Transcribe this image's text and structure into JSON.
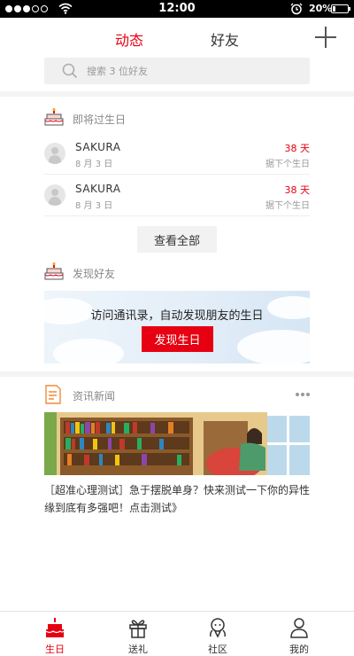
{
  "status_bar": {
    "time": "12:00",
    "battery": "20%",
    "battery_level": 0.2,
    "signal_icon": "signal-dots-icon",
    "wifi_icon": "wifi-icon",
    "alarm_icon": "alarm-icon"
  },
  "nav": {
    "tabs": [
      {
        "label": "动态",
        "active": true
      },
      {
        "label": "好友",
        "active": false
      }
    ],
    "add_icon": "plus-icon"
  },
  "search": {
    "placeholder": "搜索 3 位好友"
  },
  "upcoming": {
    "title": "即将过生日",
    "icon": "cake-icon",
    "friends": [
      {
        "name": "SAKURA",
        "date": "8 月 3 日",
        "days": "38 天",
        "note": "据下个生日"
      },
      {
        "name": "SAKURA",
        "date": "8 月 3 日",
        "days": "38 天",
        "note": "据下个生日"
      }
    ],
    "view_all": "查看全部"
  },
  "discover": {
    "title": "发现好友",
    "icon": "cake-icon",
    "banner_text": "访问通讯录，自动发现朋友的生日",
    "button": "发现生日"
  },
  "news": {
    "title": "资讯新闻",
    "icon": "news-icon",
    "more_icon": "more-dots-icon",
    "article": "［超准心理测试］急于摆脱单身？快来测试一下你的异性缘到底有多强吧！点击测试》"
  },
  "tabbar": [
    {
      "label": "生日",
      "icon": "birthday-cake-icon",
      "active": true
    },
    {
      "label": "送礼",
      "icon": "gift-icon",
      "active": false
    },
    {
      "label": "社区",
      "icon": "community-icon",
      "active": false
    },
    {
      "label": "我的",
      "icon": "profile-icon",
      "active": false
    }
  ],
  "colors": {
    "accent": "#e60012",
    "muted_text": "#999999",
    "section_bg": "#f4f4f4"
  }
}
